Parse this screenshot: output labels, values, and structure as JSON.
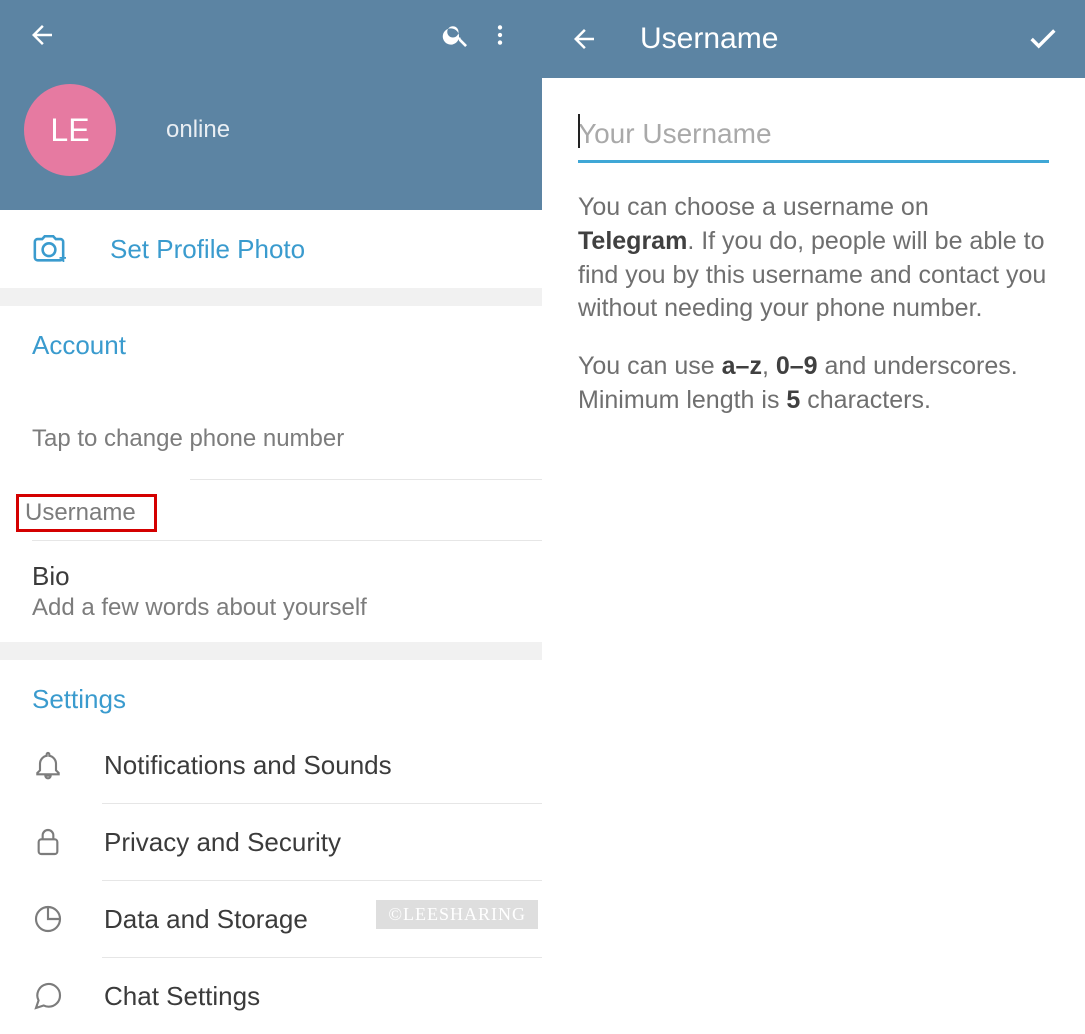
{
  "left": {
    "avatar_initials": "LE",
    "status": "online",
    "set_photo_label": "Set Profile Photo",
    "section_account": "Account",
    "phone_hint": "Tap to change phone number",
    "username_label": "Username",
    "bio_label": "Bio",
    "bio_hint": "Add a few words about yourself",
    "section_settings": "Settings",
    "settings_items": {
      "notifications": "Notifications and Sounds",
      "privacy": "Privacy and Security",
      "data": "Data and Storage",
      "chat": "Chat Settings"
    }
  },
  "right": {
    "title": "Username",
    "input_placeholder": "Your Username",
    "desc1_pre": "You can choose a username on ",
    "desc1_bold": "Telegram",
    "desc1_post": ". If you do, people will be able to find you by this username and contact you without needing your phone number.",
    "desc2_pre": "You can use ",
    "desc2_b1": "a–z",
    "desc2_mid1": ", ",
    "desc2_b2": "0–9",
    "desc2_mid2": " and underscores. Minimum length is ",
    "desc2_b3": "5",
    "desc2_post": " characters."
  },
  "watermark": "©LEESHARING"
}
